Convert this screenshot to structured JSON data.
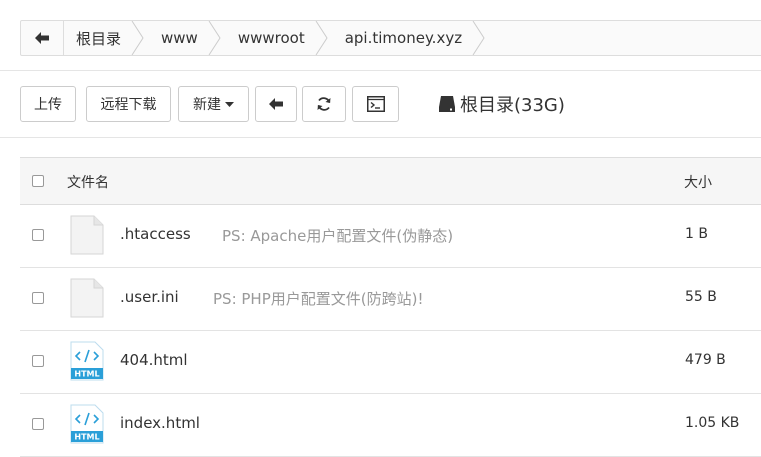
{
  "breadcrumb": {
    "items": [
      "根目录",
      "www",
      "wwwroot",
      "api.timoney.xyz"
    ]
  },
  "toolbar": {
    "upload": "上传",
    "remote_download": "远程下载",
    "new": "新建",
    "disk_label": "根目录(33G)"
  },
  "table": {
    "headers": {
      "name": "文件名",
      "size": "大小"
    },
    "rows": [
      {
        "name": ".htaccess",
        "note": "PS: Apache用户配置文件(伪静态)",
        "size": "1 B",
        "icon": "file-icon"
      },
      {
        "name": ".user.ini",
        "note": "PS: PHP用户配置文件(防跨站)!",
        "size": "55 B",
        "icon": "file-icon"
      },
      {
        "name": "404.html",
        "note": "",
        "size": "479 B",
        "icon": "html-file-icon",
        "icon_badge": "HTML"
      },
      {
        "name": "index.html",
        "note": "",
        "size": "1.05 KB",
        "icon": "html-file-icon",
        "icon_badge": "HTML"
      }
    ]
  },
  "colors": {
    "html_badge": "#2a9fd8",
    "file_icon_fill": "#f3f3f3"
  }
}
